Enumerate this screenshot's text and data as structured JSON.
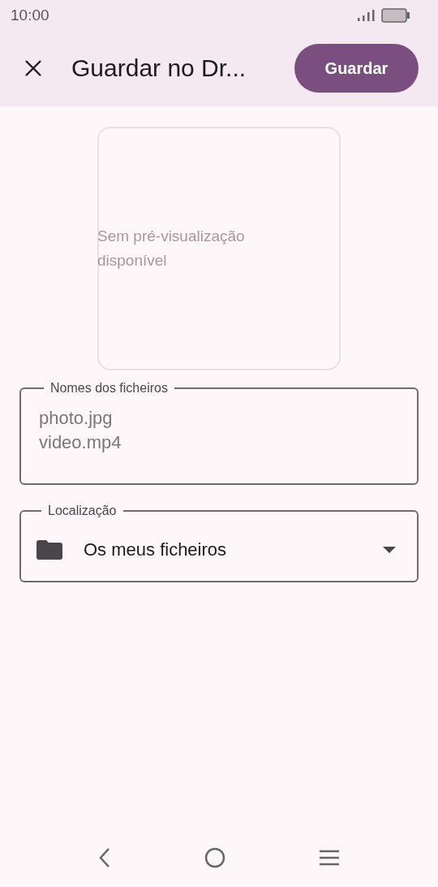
{
  "status_bar": {
    "time": "10:00"
  },
  "app_bar": {
    "title": "Guardar no Dr...",
    "action": "Guardar"
  },
  "preview": {
    "message": "Sem pré-visualização disponível"
  },
  "file_names": {
    "label": "Nomes dos ficheiros",
    "value": "photo.jpg\nvideo.mp4"
  },
  "location": {
    "label": "Localização",
    "value": "Os meus ficheiros"
  }
}
